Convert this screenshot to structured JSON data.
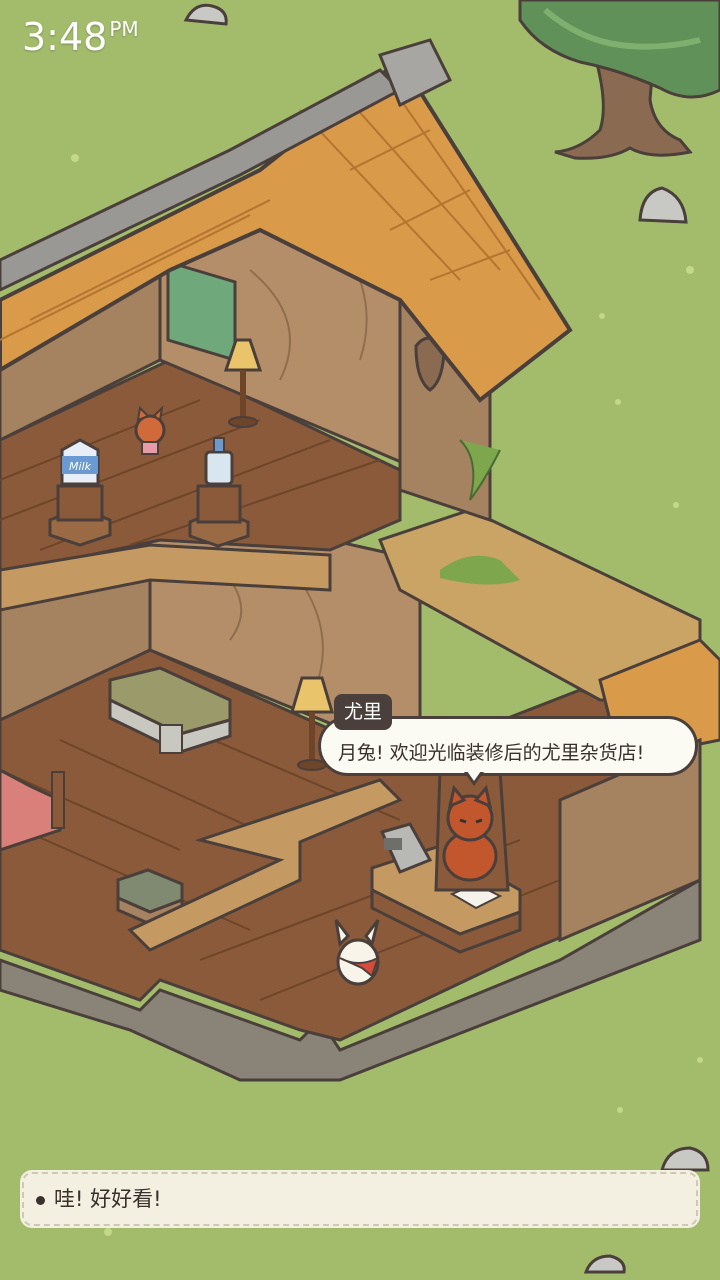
{
  "status_bar": {
    "time": "3:48",
    "ampm": "PM"
  },
  "dialogue": {
    "speaker": "尤里",
    "line": "月兔! 欢迎光临装修后的尤里杂货店!"
  },
  "reply_option": {
    "text": "哇! 好好看!"
  },
  "props": {
    "milk_carton_label": "Milk"
  },
  "colors": {
    "grass": "#a3bc6c",
    "roof": "#d99a4a",
    "wood_floor": "#8a5a3a",
    "bubble_bg": "#fbfaf3",
    "bubble_border": "#4a3f3a"
  }
}
